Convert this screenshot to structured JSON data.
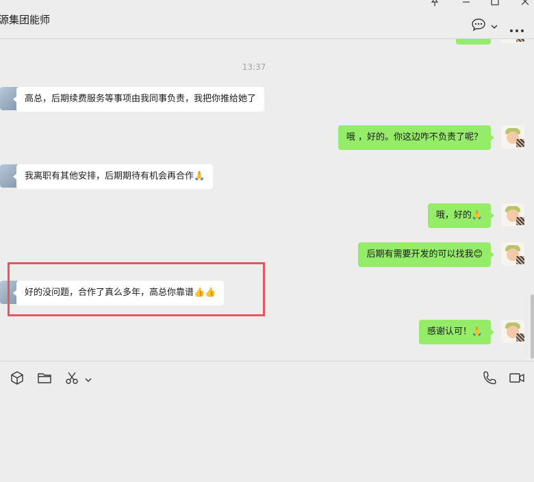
{
  "header": {
    "title": "源集团能师"
  },
  "window_controls": [
    "pin-icon",
    "minimize-icon",
    "maximize-icon",
    "close-icon"
  ],
  "chat": {
    "timestamp": "13:37",
    "messages": [
      {
        "side": "in",
        "text": "高总，后期续费服务等事项由我同事负责，我把你推给她了"
      },
      {
        "side": "out",
        "text": "哦 ，好的。你这边咋不负责了呢？"
      },
      {
        "side": "in",
        "text": "我离职有其他安排，后期期待有机会再合作🙏"
      },
      {
        "side": "out",
        "text": "哦，好的🙏"
      },
      {
        "side": "out",
        "text": "后期有需要开发的可以找我😊"
      },
      {
        "side": "in",
        "text": "好的没问题，合作了真么多年，高总你靠谱👍👍"
      },
      {
        "side": "out",
        "text": "感谢认可！🙏"
      }
    ]
  },
  "toolbar": {
    "left": [
      "sticker-icon",
      "folder-icon",
      "scissors-icon",
      "chevron-down-icon"
    ],
    "right": [
      "phone-icon",
      "video-call-icon"
    ]
  },
  "colors": {
    "background": "#ededed",
    "incoming_bubble": "#ffffff",
    "outgoing_bubble": "#95ec69",
    "highlight": "#e9545a"
  }
}
